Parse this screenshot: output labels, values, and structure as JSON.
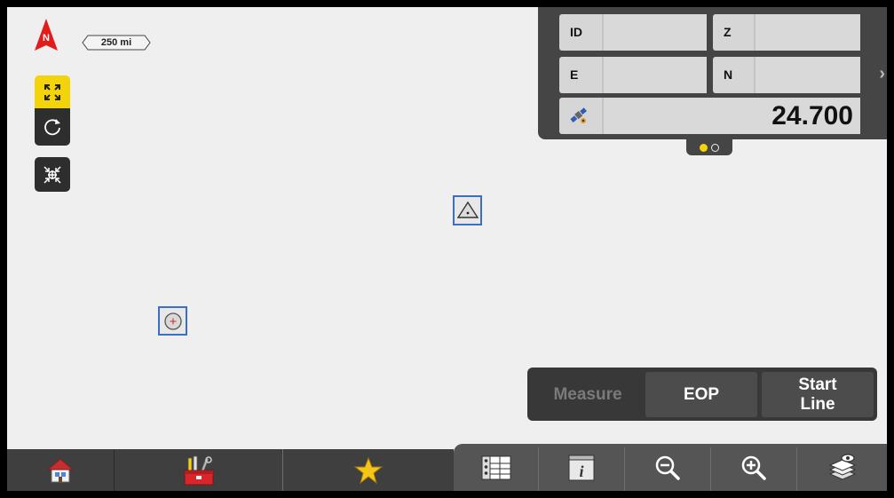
{
  "map": {
    "north_label": "N",
    "scale_label": "250 mi"
  },
  "left_tools": [
    {
      "name": "zoom-extents",
      "icon": "expand-arrows-icon",
      "active": true
    },
    {
      "name": "refresh",
      "icon": "refresh-icon"
    },
    {
      "name": "center-on-position",
      "icon": "crosshair-target-icon"
    }
  ],
  "markers": [
    {
      "kind": "control-point",
      "icon": "triangle-point-icon"
    },
    {
      "kind": "survey-point",
      "icon": "circle-point-icon"
    }
  ],
  "info_panel": {
    "rows": [
      [
        {
          "label": "ID",
          "value": ""
        },
        {
          "label": "Z",
          "value": ""
        }
      ],
      [
        {
          "label": "E",
          "value": ""
        },
        {
          "label": "N",
          "value": ""
        }
      ]
    ],
    "gnss_value": "24.700",
    "page_count": 2,
    "active_page": 1
  },
  "measure_bar": {
    "measure_label": "Measure",
    "eop_label": "EOP",
    "start_line_label_1": "Start",
    "start_line_label_2": "Line"
  },
  "bottom_toolbar": [
    {
      "icon": "home-icon"
    },
    {
      "icon": "toolbox-icon"
    },
    {
      "icon": "star-icon"
    },
    {
      "icon": "table-icon"
    },
    {
      "icon": "info-icon"
    },
    {
      "icon": "zoom-out-icon"
    },
    {
      "icon": "zoom-in-icon"
    },
    {
      "icon": "layers-icon"
    }
  ],
  "colors": {
    "accent_yellow": "#f3d40b",
    "north_red": "#e31b1b",
    "marker_blue": "#3a6fc2",
    "panel_dark": "#454545"
  }
}
